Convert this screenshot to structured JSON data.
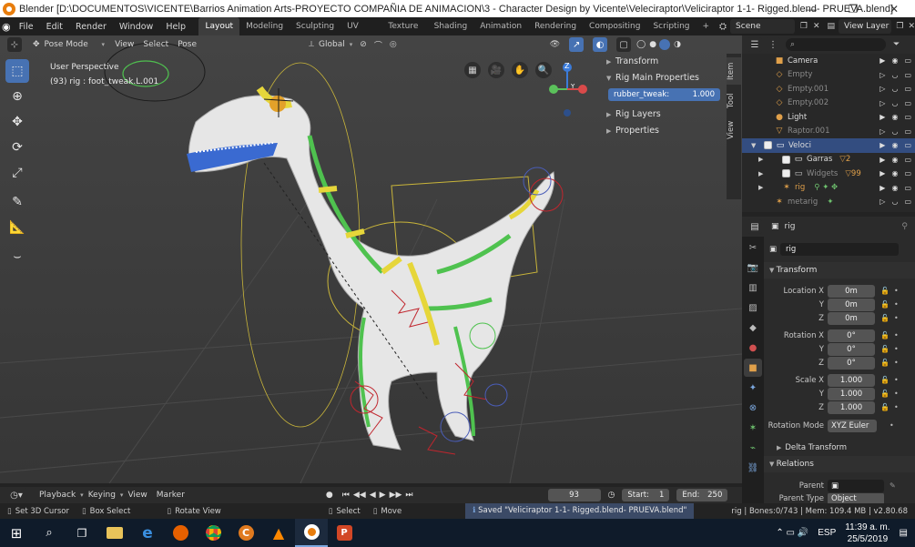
{
  "window": {
    "title": "Blender [D:\\DOCUMENTOS\\VICENTE\\Barrios Animation Arts-PROYECTO COMPAÑIA DE ANIMACION\\3 - Character Design by Vicente\\Veleciraptor\\Veliciraptor 1-1- Rigged.blend- PRUEVA.blend]",
    "minimize": "—",
    "maximize": "❐",
    "close": "✕"
  },
  "menu": [
    "File",
    "Edit",
    "Render",
    "Window",
    "Help"
  ],
  "workspaces": [
    "Layout",
    "Modeling",
    "Sculpting",
    "UV Editing",
    "Texture Paint",
    "Shading",
    "Animation",
    "Rendering",
    "Compositing",
    "Scripting"
  ],
  "workspace_add": "+",
  "scene": "Scene",
  "view_layer": "View Layer",
  "viewport_header": {
    "mode": "Pose Mode",
    "menus": [
      "View",
      "Select",
      "Pose"
    ],
    "orientation": "Global"
  },
  "viewport_info": {
    "line1": "User Perspective",
    "line2": "(93) rig : foot_tweak.L.001"
  },
  "gizmo": {
    "z": "Z",
    "y": "Y"
  },
  "npanel": {
    "sections": {
      "transform": "Transform",
      "rig_main": "Rig Main Properties",
      "rig_layers": "Rig Layers",
      "properties": "Properties"
    },
    "slider": {
      "label": "rubber_tweak:",
      "value": "1.000"
    },
    "tabs": [
      "Item",
      "Tool",
      "View"
    ]
  },
  "outliner": {
    "items": [
      {
        "name": "Camera",
        "icon": "camera-icon",
        "dim": false
      },
      {
        "name": "Empty",
        "icon": "empty-icon",
        "dim": true
      },
      {
        "name": "Empty.001",
        "icon": "empty-icon",
        "dim": true
      },
      {
        "name": "Empty.002",
        "icon": "empty-icon",
        "dim": true
      },
      {
        "name": "Light",
        "icon": "light-icon",
        "dim": false
      },
      {
        "name": "Raptor.001",
        "icon": "mesh-icon",
        "dim": true
      },
      {
        "name": "Veloci",
        "icon": "collection-icon",
        "dim": false
      },
      {
        "name": "Garras",
        "icon": "collection-icon",
        "dim": false
      },
      {
        "name": "Widgets",
        "icon": "collection-icon",
        "dim": true
      },
      {
        "name": "rig",
        "icon": "armature-icon",
        "dim": false
      },
      {
        "name": "metarig",
        "icon": "armature-icon",
        "dim": true
      }
    ],
    "badges": {
      "garras": "2",
      "widgets": "99"
    }
  },
  "properties": {
    "header_object": "rig",
    "object_name": "rig",
    "transform_title": "Transform",
    "location": {
      "label": "Location X",
      "x": "0m",
      "y": "0m",
      "z": "0m"
    },
    "rotation": {
      "label": "Rotation X",
      "x": "0°",
      "y": "0°",
      "z": "0°"
    },
    "scale": {
      "label": "Scale X",
      "x": "1.000",
      "y": "1.000",
      "z": "1.000"
    },
    "axis": {
      "y": "Y",
      "z": "Z"
    },
    "rotation_mode_label": "Rotation Mode",
    "rotation_mode": "XYZ Euler",
    "delta_transform": "Delta Transform",
    "relations": "Relations",
    "parent_label": "Parent",
    "parent_type_label": "Parent Type",
    "parent_type": "Object"
  },
  "timeline": {
    "menus": [
      "Playback",
      "Keying",
      "View",
      "Marker"
    ],
    "frame": "93",
    "start_label": "Start:",
    "start": "1",
    "end_label": "End:",
    "end": "250"
  },
  "statusbar": {
    "cursor": "Set 3D Cursor",
    "box_select": "Box Select",
    "rotate": "Rotate View",
    "select": "Select",
    "move": "Move",
    "saved": "Saved \"Veliciraptor 1-1- Rigged.blend- PRUEVA.blend\"",
    "stats": "rig | Bones:0/743 | Mem: 109.4 MB | v2.80.68"
  },
  "taskbar": {
    "lang": "ESP",
    "time": "11:39 a. m.",
    "date": "25/5/2019"
  }
}
